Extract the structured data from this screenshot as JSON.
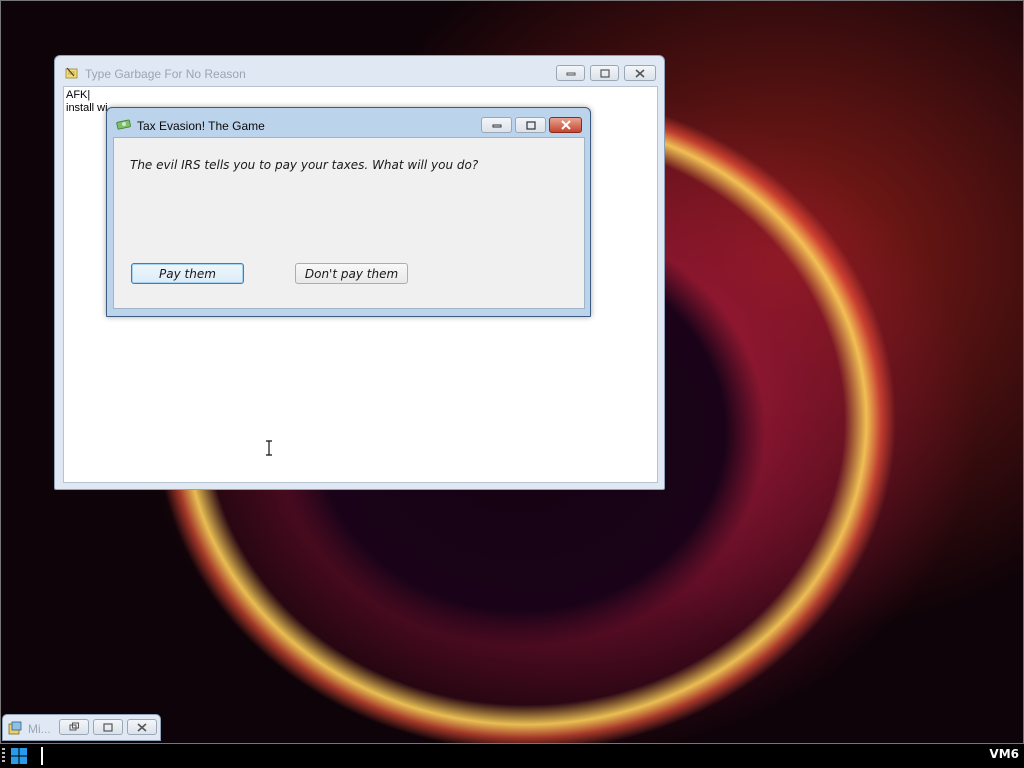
{
  "background_window": {
    "title": "Type Garbage For No Reason",
    "lines": [
      "AFK|",
      "install wi"
    ]
  },
  "dialog": {
    "title": "Tax Evasion! The Game",
    "message": "The evil IRS tells you to pay your taxes. What will you do?",
    "buttons": [
      {
        "label": "Pay them",
        "default": true
      },
      {
        "label": "Don't pay them",
        "default": false
      }
    ]
  },
  "minimized_window": {
    "label": "Mi..."
  },
  "taskbar": {
    "clock": "VM6"
  },
  "icons": {
    "notepad": "notepad-icon",
    "money": "money-icon",
    "start": "windows-start-icon",
    "text_cursor": "text-cursor-icon"
  },
  "colors": {
    "dialog_frame": "#bcd3ec",
    "close_button": "#c4452f",
    "default_button_border": "#3c7fb1",
    "taskbar": "#000000"
  }
}
